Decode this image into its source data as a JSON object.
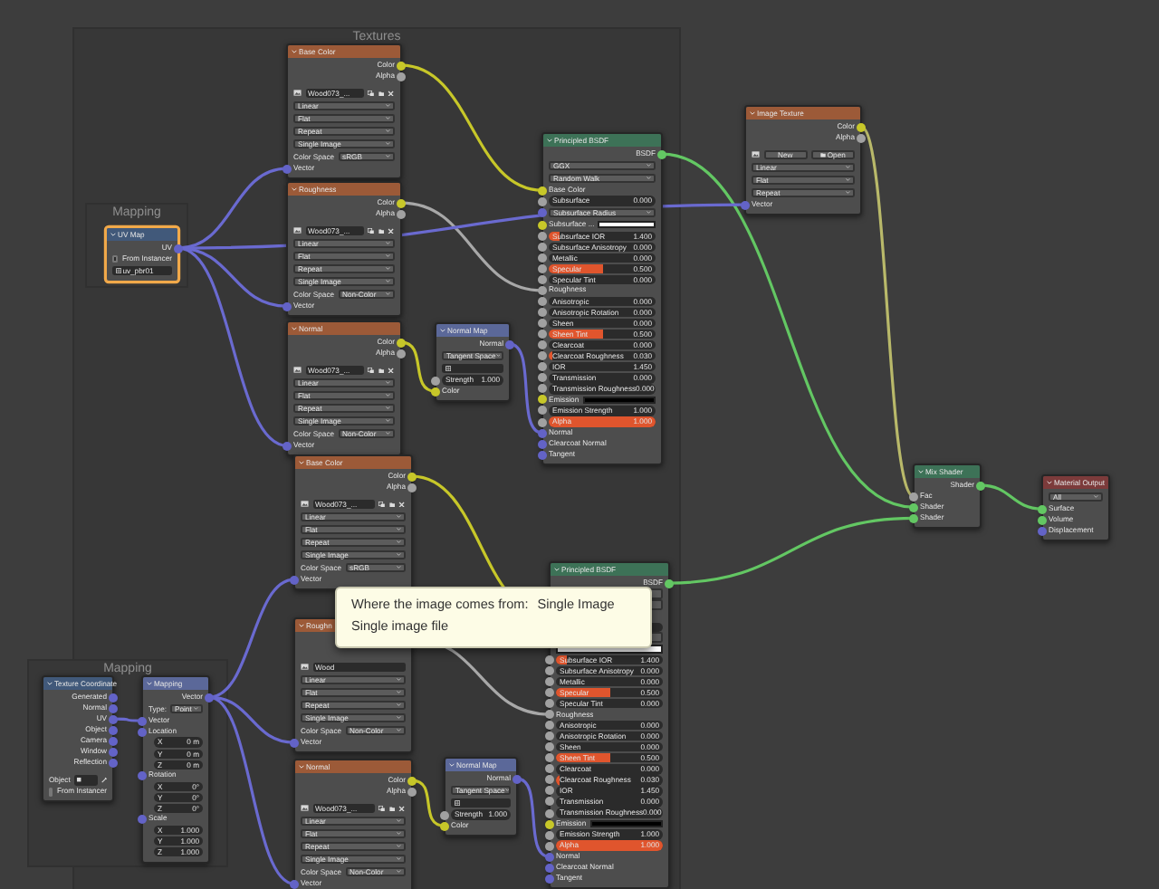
{
  "frames": [
    {
      "label": "Textures"
    },
    {
      "label": "Mapping"
    },
    {
      "label": "Mapping"
    }
  ],
  "nodes": [
    {
      "title": "Base Color",
      "kind": "texture",
      "selected": false,
      "rows": [
        {
          "kind": "output",
          "label": "Color",
          "socket": {
            "color": "#c7c729"
          }
        },
        {
          "kind": "output",
          "label": "Alpha",
          "socket": {
            "color": "#a1a1a1"
          }
        },
        {
          "kind": "image",
          "name": "Wood073_...",
          "buttons": true
        },
        {
          "kind": "dropdown",
          "value": "Linear"
        },
        {
          "kind": "dropdown",
          "value": "Flat"
        },
        {
          "kind": "dropdown",
          "value": "Repeat"
        },
        {
          "kind": "dropdown",
          "value": "Single Image"
        },
        {
          "kind": "prop",
          "label": "Color Space",
          "value": "sRGB"
        },
        {
          "kind": "input",
          "label": "Vector",
          "socket": {
            "color": "#6363c7"
          }
        }
      ]
    },
    {
      "title": "UV Map",
      "kind": "input",
      "selected": true,
      "rows": [
        {
          "kind": "output",
          "label": "UV",
          "socket": {
            "color": "#6363c7"
          }
        },
        {
          "kind": "checkbox",
          "label": "From Instancer",
          "checked": false
        },
        {
          "kind": "field",
          "value": "uv_pbr01"
        }
      ]
    },
    {
      "title": "Roughness",
      "kind": "texture",
      "selected": false,
      "rows": [
        {
          "kind": "output",
          "label": "Color",
          "socket": {
            "color": "#c7c729"
          }
        },
        {
          "kind": "output",
          "label": "Alpha",
          "socket": {
            "color": "#a1a1a1"
          }
        },
        {
          "kind": "image",
          "name": "Wood073_...",
          "buttons": true
        },
        {
          "kind": "dropdown",
          "value": "Linear"
        },
        {
          "kind": "dropdown",
          "value": "Flat"
        },
        {
          "kind": "dropdown",
          "value": "Repeat"
        },
        {
          "kind": "dropdown",
          "value": "Single Image"
        },
        {
          "kind": "prop",
          "label": "Color Space",
          "value": "Non-Color"
        },
        {
          "kind": "input",
          "label": "Vector",
          "socket": {
            "color": "#6363c7"
          }
        }
      ]
    },
    {
      "title": "Normal",
      "kind": "texture",
      "selected": false,
      "rows": [
        {
          "kind": "output",
          "label": "Color",
          "socket": {
            "color": "#c7c729"
          }
        },
        {
          "kind": "output",
          "label": "Alpha",
          "socket": {
            "color": "#a1a1a1"
          }
        },
        {
          "kind": "image",
          "name": "Wood073_...",
          "buttons": true
        },
        {
          "kind": "dropdown",
          "value": "Linear"
        },
        {
          "kind": "dropdown",
          "value": "Flat"
        },
        {
          "kind": "dropdown",
          "value": "Repeat"
        },
        {
          "kind": "dropdown",
          "value": "Single Image"
        },
        {
          "kind": "prop",
          "label": "Color Space",
          "value": "Non-Color"
        },
        {
          "kind": "input",
          "label": "Vector",
          "socket": {
            "color": "#6363c7"
          }
        }
      ]
    },
    {
      "title": "Normal Map",
      "kind": "vector",
      "selected": false,
      "rows": [
        {
          "kind": "output",
          "label": "Normal",
          "socket": {
            "color": "#6363c7"
          }
        },
        {
          "kind": "dropdown",
          "value": "Tangent Space"
        },
        {
          "kind": "field"
        },
        {
          "kind": "number",
          "label": "Strength",
          "value": "1.000",
          "socket": {
            "color": "#a1a1a1"
          }
        },
        {
          "kind": "input",
          "label": "Color",
          "socket": {
            "color": "#c7c729"
          }
        }
      ]
    },
    {
      "title": "Principled BSDF",
      "kind": "shader",
      "selected": false,
      "rows": [
        {
          "kind": "output",
          "label": "BSDF",
          "socket": {
            "color": "#63c763"
          }
        },
        {
          "kind": "dropdown",
          "value": "GGX"
        },
        {
          "kind": "dropdown",
          "value": "Random Walk"
        },
        {
          "kind": "input",
          "label": "Base Color",
          "socket": {
            "color": "#c7c729"
          }
        },
        {
          "kind": "slider",
          "label": "Subsurface",
          "value": "0.000",
          "socket": {
            "color": "#a1a1a1"
          },
          "level": 0
        },
        {
          "kind": "dropdown",
          "value": "Subsurface Radius",
          "socket": {
            "color": "#6363c7"
          }
        },
        {
          "kind": "color",
          "label": "Subsurface ...",
          "socket": {
            "color": "#c7c729"
          },
          "color": "#ffffff"
        },
        {
          "kind": "slider",
          "label": "Subsurface IOR",
          "value": "1.400",
          "socket": {
            "color": "#a1a1a1"
          },
          "level": 0.1
        },
        {
          "kind": "slider",
          "label": "Subsurface Anisotropy",
          "value": "0.000",
          "socket": {
            "color": "#a1a1a1"
          },
          "level": 0
        },
        {
          "kind": "slider",
          "label": "Metallic",
          "value": "0.000",
          "socket": {
            "color": "#a1a1a1"
          },
          "level": 0
        },
        {
          "kind": "slider",
          "label": "Specular",
          "value": "0.500",
          "socket": {
            "color": "#a1a1a1"
          },
          "level": 0.5
        },
        {
          "kind": "slider",
          "label": "Specular Tint",
          "value": "0.000",
          "socket": {
            "color": "#a1a1a1"
          },
          "level": 0
        },
        {
          "kind": "input",
          "label": "Roughness",
          "socket": {
            "color": "#a1a1a1"
          }
        },
        {
          "kind": "slider",
          "label": "Anisotropic",
          "value": "0.000",
          "socket": {
            "color": "#a1a1a1"
          },
          "level": 0
        },
        {
          "kind": "slider",
          "label": "Anisotropic Rotation",
          "value": "0.000",
          "socket": {
            "color": "#a1a1a1"
          },
          "level": 0
        },
        {
          "kind": "slider",
          "label": "Sheen",
          "value": "0.000",
          "socket": {
            "color": "#a1a1a1"
          },
          "level": 0
        },
        {
          "kind": "slider",
          "label": "Sheen Tint",
          "value": "0.500",
          "socket": {
            "color": "#a1a1a1"
          },
          "level": 0.5
        },
        {
          "kind": "slider",
          "label": "Clearcoat",
          "value": "0.000",
          "socket": {
            "color": "#a1a1a1"
          },
          "level": 0
        },
        {
          "kind": "slider",
          "label": "Clearcoat Roughness",
          "value": "0.030",
          "socket": {
            "color": "#a1a1a1"
          },
          "level": 0.03
        },
        {
          "kind": "number",
          "label": "IOR",
          "value": "1.450",
          "socket": {
            "color": "#a1a1a1"
          }
        },
        {
          "kind": "slider",
          "label": "Transmission",
          "value": "0.000",
          "socket": {
            "color": "#a1a1a1"
          },
          "level": 0
        },
        {
          "kind": "slider",
          "label": "Transmission Roughness",
          "value": "0.000",
          "socket": {
            "color": "#a1a1a1"
          },
          "level": 0
        },
        {
          "kind": "color",
          "label": "Emission",
          "socket": {
            "color": "#c7c729"
          },
          "color": "#000000"
        },
        {
          "kind": "number",
          "label": "Emission Strength",
          "value": "1.000",
          "socket": {
            "color": "#a1a1a1"
          }
        },
        {
          "kind": "slider",
          "label": "Alpha",
          "value": "1.000",
          "socket": {
            "color": "#a1a1a1"
          },
          "level": 1
        },
        {
          "kind": "input",
          "label": "Normal",
          "socket": {
            "color": "#6363c7"
          }
        },
        {
          "kind": "input",
          "label": "Clearcoat Normal",
          "socket": {
            "color": "#6363c7"
          }
        },
        {
          "kind": "input",
          "label": "Tangent",
          "socket": {
            "color": "#6363c7"
          }
        }
      ]
    },
    {
      "title": "Image Texture",
      "kind": "texture",
      "selected": false,
      "rows": [
        {
          "kind": "output",
          "label": "Color",
          "socket": {
            "color": "#c7c729"
          }
        },
        {
          "kind": "output",
          "label": "Alpha",
          "socket": {
            "color": "#a1a1a1"
          }
        },
        {
          "kind": "buttons",
          "new": "New",
          "open": "Open"
        },
        {
          "kind": "dropdown",
          "value": "Linear"
        },
        {
          "kind": "dropdown",
          "value": "Flat"
        },
        {
          "kind": "dropdown",
          "value": "Repeat"
        },
        {
          "kind": "input",
          "label": "Vector",
          "socket": {
            "color": "#6363c7"
          }
        }
      ]
    },
    {
      "title": "Base Color",
      "kind": "texture",
      "selected": false,
      "rows": [
        {
          "kind": "output",
          "label": "Color",
          "socket": {
            "color": "#c7c729"
          }
        },
        {
          "kind": "output",
          "label": "Alpha",
          "socket": {
            "color": "#a1a1a1"
          }
        },
        {
          "kind": "image",
          "name": "Wood073_...",
          "buttons": true
        },
        {
          "kind": "dropdown",
          "value": "Linear"
        },
        {
          "kind": "dropdown",
          "value": "Flat"
        },
        {
          "kind": "dropdown",
          "value": "Repeat"
        },
        {
          "kind": "dropdown",
          "value": "Single Image"
        },
        {
          "kind": "prop",
          "label": "Color Space",
          "value": "sRGB"
        },
        {
          "kind": "input",
          "label": "Vector",
          "socket": {
            "color": "#6363c7"
          }
        }
      ]
    },
    {
      "title": "Texture Coordinate",
      "kind": "input",
      "selected": false,
      "rows": [
        {
          "kind": "output",
          "label": "Generated",
          "socket": {
            "color": "#6363c7"
          }
        },
        {
          "kind": "output",
          "label": "Normal",
          "socket": {
            "color": "#6363c7"
          }
        },
        {
          "kind": "output",
          "label": "UV",
          "socket": {
            "color": "#6363c7"
          }
        },
        {
          "kind": "output",
          "label": "Object",
          "socket": {
            "color": "#6363c7"
          }
        },
        {
          "kind": "output",
          "label": "Camera",
          "socket": {
            "color": "#6363c7"
          }
        },
        {
          "kind": "output",
          "label": "Window",
          "socket": {
            "color": "#6363c7"
          }
        },
        {
          "kind": "output",
          "label": "Reflection",
          "socket": {
            "color": "#6363c7"
          }
        },
        {
          "kind": "object",
          "label": "Object"
        },
        {
          "kind": "checkbox",
          "label": "From Instancer",
          "checked": false
        }
      ]
    },
    {
      "title": "Mapping",
      "kind": "vector",
      "selected": false,
      "rows": [
        {
          "kind": "output",
          "label": "Vector",
          "socket": {
            "color": "#6363c7"
          }
        },
        {
          "kind": "prop",
          "label": "Type:",
          "value": "Point"
        },
        {
          "kind": "input",
          "label": "Vector",
          "socket": {
            "color": "#6363c7"
          }
        },
        {
          "kind": "label",
          "label": "Location",
          "socket": {
            "color": "#6363c7"
          }
        },
        {
          "kind": "axis",
          "label": "X",
          "value": "0 m"
        },
        {
          "kind": "axis",
          "label": "Y",
          "value": "0 m"
        },
        {
          "kind": "axis",
          "label": "Z",
          "value": "0 m"
        },
        {
          "kind": "label",
          "label": "Rotation",
          "socket": {
            "color": "#6363c7"
          }
        },
        {
          "kind": "axis",
          "label": "X",
          "value": "0°"
        },
        {
          "kind": "axis",
          "label": "Y",
          "value": "0°"
        },
        {
          "kind": "axis",
          "label": "Z",
          "value": "0°"
        },
        {
          "kind": "label",
          "label": "Scale",
          "socket": {
            "color": "#6363c7"
          }
        },
        {
          "kind": "axis",
          "label": "X",
          "value": "1.000"
        },
        {
          "kind": "axis",
          "label": "Y",
          "value": "1.000"
        },
        {
          "kind": "axis",
          "label": "Z",
          "value": "1.000"
        }
      ]
    },
    {
      "title": "Roughn",
      "kind": "texture",
      "selected": false,
      "rows": [
        {
          "kind": "output"
        },
        {
          "kind": "output"
        },
        {
          "kind": "image",
          "name": "Wood",
          "buttons": false
        },
        {
          "kind": "dropdown",
          "value": "Linear"
        },
        {
          "kind": "dropdown",
          "value": "Flat"
        },
        {
          "kind": "dropdown",
          "value": "Repeat"
        },
        {
          "kind": "dropdown",
          "value": "Single Image"
        },
        {
          "kind": "prop",
          "label": "Color Space",
          "value": "Non-Color"
        },
        {
          "kind": "input",
          "label": "Vector",
          "socket": {
            "color": "#6363c7"
          }
        }
      ]
    },
    {
      "title": "Normal",
      "kind": "texture",
      "selected": false,
      "rows": [
        {
          "kind": "output",
          "label": "Color",
          "socket": {
            "color": "#c7c729"
          }
        },
        {
          "kind": "output",
          "label": "Alpha",
          "socket": {
            "color": "#a1a1a1"
          }
        },
        {
          "kind": "image",
          "name": "Wood073_...",
          "buttons": true
        },
        {
          "kind": "dropdown",
          "value": "Linear"
        },
        {
          "kind": "dropdown",
          "value": "Flat"
        },
        {
          "kind": "dropdown",
          "value": "Repeat"
        },
        {
          "kind": "dropdown",
          "value": "Single Image"
        },
        {
          "kind": "prop",
          "label": "Color Space",
          "value": "Non-Color"
        },
        {
          "kind": "input",
          "label": "Vector",
          "socket": {
            "color": "#6363c7"
          }
        }
      ]
    },
    {
      "title": "Normal Map",
      "kind": "vector",
      "selected": false,
      "rows": [
        {
          "kind": "output",
          "label": "Normal",
          "socket": {
            "color": "#6363c7"
          }
        },
        {
          "kind": "dropdown",
          "value": "Tangent Space"
        },
        {
          "kind": "field"
        },
        {
          "kind": "number",
          "label": "Strength",
          "value": "1.000",
          "socket": {
            "color": "#a1a1a1"
          }
        },
        {
          "kind": "input",
          "label": "Color",
          "socket": {
            "color": "#c7c729"
          }
        }
      ]
    },
    {
      "title": "Principled BSDF",
      "kind": "shader",
      "selected": false,
      "rows": [
        {
          "kind": "output",
          "label": "BSDF",
          "socket": {
            "color": "#63c763"
          }
        },
        {
          "kind": "dropdown"
        },
        {
          "kind": "dropdown"
        },
        {
          "kind": "input"
        },
        {
          "kind": "number"
        },
        {
          "kind": "dropdown"
        },
        {
          "kind": "color",
          "color": "#ffffff"
        },
        {
          "kind": "slider",
          "label": "Subsurface IOR",
          "value": "1.400",
          "socket": {
            "color": "#a1a1a1"
          },
          "level": 0.1
        },
        {
          "kind": "slider",
          "label": "Subsurface Anisotropy",
          "value": "0.000",
          "socket": {
            "color": "#a1a1a1"
          },
          "level": 0
        },
        {
          "kind": "slider",
          "label": "Metallic",
          "value": "0.000",
          "socket": {
            "color": "#a1a1a1"
          },
          "level": 0
        },
        {
          "kind": "slider",
          "label": "Specular",
          "value": "0.500",
          "socket": {
            "color": "#a1a1a1"
          },
          "level": 0.5
        },
        {
          "kind": "slider",
          "label": "Specular Tint",
          "value": "0.000",
          "socket": {
            "color": "#a1a1a1"
          },
          "level": 0
        },
        {
          "kind": "input",
          "label": "Roughness",
          "socket": {
            "color": "#a1a1a1"
          }
        },
        {
          "kind": "slider",
          "label": "Anisotropic",
          "value": "0.000",
          "socket": {
            "color": "#a1a1a1"
          },
          "level": 0
        },
        {
          "kind": "slider",
          "label": "Anisotropic Rotation",
          "value": "0.000",
          "socket": {
            "color": "#a1a1a1"
          },
          "level": 0
        },
        {
          "kind": "slider",
          "label": "Sheen",
          "value": "0.000",
          "socket": {
            "color": "#a1a1a1"
          },
          "level": 0
        },
        {
          "kind": "slider",
          "label": "Sheen Tint",
          "value": "0.500",
          "socket": {
            "color": "#a1a1a1"
          },
          "level": 0.5
        },
        {
          "kind": "slider",
          "label": "Clearcoat",
          "value": "0.000",
          "socket": {
            "color": "#a1a1a1"
          },
          "level": 0
        },
        {
          "kind": "slider",
          "label": "Clearcoat Roughness",
          "value": "0.030",
          "socket": {
            "color": "#a1a1a1"
          },
          "level": 0.03
        },
        {
          "kind": "number",
          "label": "IOR",
          "value": "1.450",
          "socket": {
            "color": "#a1a1a1"
          }
        },
        {
          "kind": "slider",
          "label": "Transmission",
          "value": "0.000",
          "socket": {
            "color": "#a1a1a1"
          },
          "level": 0
        },
        {
          "kind": "slider",
          "label": "Transmission Roughness",
          "value": "0.000",
          "socket": {
            "color": "#a1a1a1"
          },
          "level": 0
        },
        {
          "kind": "color",
          "label": "Emission",
          "socket": {
            "color": "#c7c729"
          },
          "color": "#000000"
        },
        {
          "kind": "number",
          "label": "Emission Strength",
          "value": "1.000",
          "socket": {
            "color": "#a1a1a1"
          }
        },
        {
          "kind": "slider",
          "label": "Alpha",
          "value": "1.000",
          "socket": {
            "color": "#a1a1a1"
          },
          "level": 1
        },
        {
          "kind": "input",
          "label": "Normal",
          "socket": {
            "color": "#6363c7"
          }
        },
        {
          "kind": "input",
          "label": "Clearcoat Normal",
          "socket": {
            "color": "#6363c7"
          }
        },
        {
          "kind": "input",
          "label": "Tangent",
          "socket": {
            "color": "#6363c7"
          }
        }
      ]
    },
    {
      "title": "Mix Shader",
      "kind": "shader",
      "selected": false,
      "rows": [
        {
          "kind": "output",
          "label": "Shader",
          "socket": {
            "color": "#63c763"
          }
        },
        {
          "kind": "input",
          "label": "Fac",
          "socket": {
            "color": "#a1a1a1"
          }
        },
        {
          "kind": "input",
          "label": "Shader",
          "socket": {
            "color": "#63c763"
          }
        },
        {
          "kind": "input",
          "label": "Shader",
          "socket": {
            "color": "#63c763"
          }
        }
      ]
    },
    {
      "title": "Material Output",
      "kind": "output",
      "selected": false,
      "rows": [
        {
          "kind": "dropdown",
          "value": "All"
        },
        {
          "kind": "input",
          "label": "Surface",
          "socket": {
            "color": "#63c763"
          }
        },
        {
          "kind": "input",
          "label": "Volume",
          "socket": {
            "color": "#63c763"
          }
        },
        {
          "kind": "input",
          "label": "Displacement",
          "socket": {
            "color": "#6363c7"
          }
        }
      ]
    }
  ],
  "tooltip": {
    "title": "Where the image comes from:",
    "value": "Single Image",
    "description": "Single image file"
  }
}
